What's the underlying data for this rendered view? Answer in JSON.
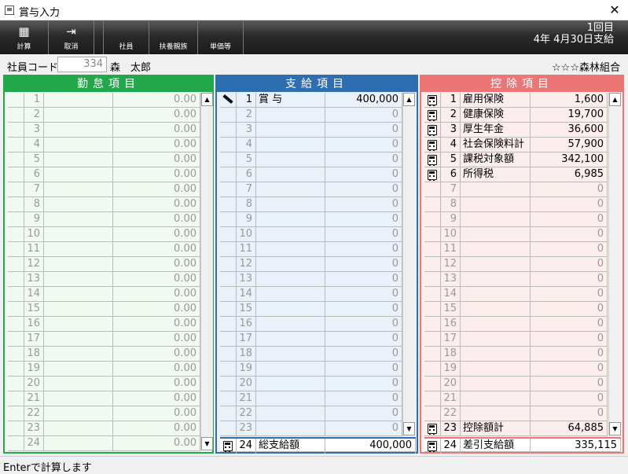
{
  "window": {
    "title": "賞与入力",
    "close": "✕"
  },
  "toolbar": {
    "buttons": [
      {
        "label": "計算",
        "icon": "abacus-icon"
      },
      {
        "label": "取消",
        "icon": "exit-door-icon"
      },
      {
        "label": "社員",
        "icon": ""
      },
      {
        "label": "扶養親族",
        "icon": ""
      },
      {
        "label": "単価等",
        "icon": ""
      }
    ],
    "round": "1回目",
    "pay_date": "4年 4月30日支給"
  },
  "employee": {
    "code_label": "社員コード",
    "code": "334",
    "name": "森　太郎",
    "company": "☆☆☆森林組合"
  },
  "attendance": {
    "header": "勤怠項目",
    "rows": [
      {
        "n": "1",
        "label": "",
        "value": "0.00"
      },
      {
        "n": "2",
        "label": "",
        "value": "0.00"
      },
      {
        "n": "3",
        "label": "",
        "value": "0.00"
      },
      {
        "n": "4",
        "label": "",
        "value": "0.00"
      },
      {
        "n": "5",
        "label": "",
        "value": "0.00"
      },
      {
        "n": "6",
        "label": "",
        "value": "0.00"
      },
      {
        "n": "7",
        "label": "",
        "value": "0.00"
      },
      {
        "n": "8",
        "label": "",
        "value": "0.00"
      },
      {
        "n": "9",
        "label": "",
        "value": "0.00"
      },
      {
        "n": "10",
        "label": "",
        "value": "0.00"
      },
      {
        "n": "11",
        "label": "",
        "value": "0.00"
      },
      {
        "n": "12",
        "label": "",
        "value": "0.00"
      },
      {
        "n": "13",
        "label": "",
        "value": "0.00"
      },
      {
        "n": "14",
        "label": "",
        "value": "0.00"
      },
      {
        "n": "15",
        "label": "",
        "value": "0.00"
      },
      {
        "n": "16",
        "label": "",
        "value": "0.00"
      },
      {
        "n": "17",
        "label": "",
        "value": "0.00"
      },
      {
        "n": "18",
        "label": "",
        "value": "0.00"
      },
      {
        "n": "19",
        "label": "",
        "value": "0.00"
      },
      {
        "n": "20",
        "label": "",
        "value": "0.00"
      },
      {
        "n": "21",
        "label": "",
        "value": "0.00"
      },
      {
        "n": "22",
        "label": "",
        "value": "0.00"
      },
      {
        "n": "23",
        "label": "",
        "value": "0.00"
      },
      {
        "n": "24",
        "label": "",
        "value": "0.00"
      }
    ]
  },
  "payment": {
    "header": "支給項目",
    "rows": [
      {
        "n": "1",
        "label": "賞 与",
        "value": "400,000",
        "active": true,
        "icon": "pencil"
      },
      {
        "n": "2",
        "label": "",
        "value": "0"
      },
      {
        "n": "3",
        "label": "",
        "value": "0"
      },
      {
        "n": "4",
        "label": "",
        "value": "0"
      },
      {
        "n": "5",
        "label": "",
        "value": "0"
      },
      {
        "n": "6",
        "label": "",
        "value": "0"
      },
      {
        "n": "7",
        "label": "",
        "value": "0"
      },
      {
        "n": "8",
        "label": "",
        "value": "0"
      },
      {
        "n": "9",
        "label": "",
        "value": "0"
      },
      {
        "n": "10",
        "label": "",
        "value": "0"
      },
      {
        "n": "11",
        "label": "",
        "value": "0"
      },
      {
        "n": "12",
        "label": "",
        "value": "0"
      },
      {
        "n": "13",
        "label": "",
        "value": "0"
      },
      {
        "n": "14",
        "label": "",
        "value": "0"
      },
      {
        "n": "15",
        "label": "",
        "value": "0"
      },
      {
        "n": "16",
        "label": "",
        "value": "0"
      },
      {
        "n": "17",
        "label": "",
        "value": "0"
      },
      {
        "n": "18",
        "label": "",
        "value": "0"
      },
      {
        "n": "19",
        "label": "",
        "value": "0"
      },
      {
        "n": "20",
        "label": "",
        "value": "0"
      },
      {
        "n": "21",
        "label": "",
        "value": "0"
      },
      {
        "n": "22",
        "label": "",
        "value": "0"
      },
      {
        "n": "23",
        "label": "",
        "value": "0"
      }
    ],
    "total": {
      "n": "24",
      "label": "総支給額",
      "value": "400,000"
    }
  },
  "deduction": {
    "header": "控除項目",
    "rows": [
      {
        "n": "1",
        "label": "雇用保険",
        "value": "1,600",
        "active": true,
        "icon": "calc"
      },
      {
        "n": "2",
        "label": "健康保険",
        "value": "19,700",
        "active": true,
        "icon": "calc"
      },
      {
        "n": "3",
        "label": "厚生年金",
        "value": "36,600",
        "active": true,
        "icon": "calc"
      },
      {
        "n": "4",
        "label": "社会保険料計",
        "value": "57,900",
        "active": true,
        "icon": "calc"
      },
      {
        "n": "5",
        "label": "課税対象額",
        "value": "342,100",
        "active": true,
        "icon": "calc"
      },
      {
        "n": "6",
        "label": "所得税",
        "value": "6,985",
        "active": true,
        "icon": "calc"
      },
      {
        "n": "7",
        "label": "",
        "value": "0"
      },
      {
        "n": "8",
        "label": "",
        "value": "0"
      },
      {
        "n": "9",
        "label": "",
        "value": "0"
      },
      {
        "n": "10",
        "label": "",
        "value": "0"
      },
      {
        "n": "11",
        "label": "",
        "value": "0"
      },
      {
        "n": "12",
        "label": "",
        "value": "0"
      },
      {
        "n": "13",
        "label": "",
        "value": "0"
      },
      {
        "n": "14",
        "label": "",
        "value": "0"
      },
      {
        "n": "15",
        "label": "",
        "value": "0"
      },
      {
        "n": "16",
        "label": "",
        "value": "0"
      },
      {
        "n": "17",
        "label": "",
        "value": "0"
      },
      {
        "n": "18",
        "label": "",
        "value": "0"
      },
      {
        "n": "19",
        "label": "",
        "value": "0"
      },
      {
        "n": "20",
        "label": "",
        "value": "0"
      },
      {
        "n": "21",
        "label": "",
        "value": "0"
      },
      {
        "n": "22",
        "label": "",
        "value": "0"
      },
      {
        "n": "23",
        "label": "控除額計",
        "value": "64,885",
        "active": true,
        "icon": "calc"
      }
    ],
    "total": {
      "n": "24",
      "label": "差引支給額",
      "value": "335,115"
    }
  },
  "status": "Enterで計算します",
  "colors": {
    "attendance": "#22a84a",
    "payment": "#2e6db0",
    "deduction": "#ec7575"
  }
}
